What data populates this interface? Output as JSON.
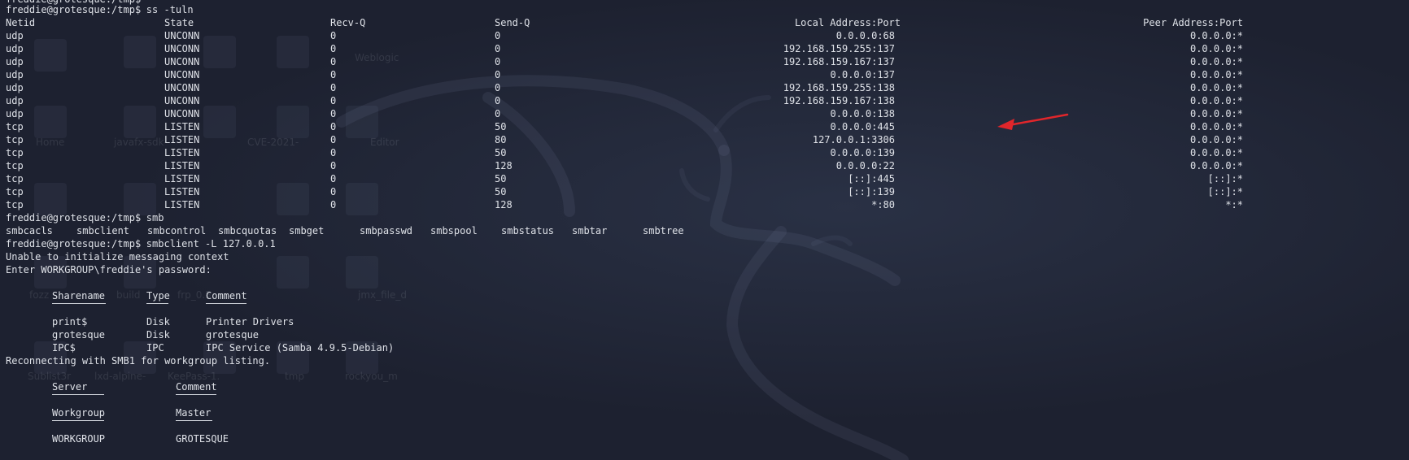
{
  "prompt": "freddie@grotesque:/tmp$",
  "commands": {
    "ss": "ss -tuln",
    "smb": "smb",
    "smbclient": "smbclient -L 127.0.0.1"
  },
  "ss_headers": [
    "Netid",
    "State",
    "Recv-Q",
    "Send-Q",
    "Local Address:Port",
    "Peer Address:Port"
  ],
  "ss_rows": [
    [
      "udp",
      "UNCONN",
      "0",
      "0",
      "0.0.0.0:68",
      "0.0.0.0:*"
    ],
    [
      "udp",
      "UNCONN",
      "0",
      "0",
      "192.168.159.255:137",
      "0.0.0.0:*"
    ],
    [
      "udp",
      "UNCONN",
      "0",
      "0",
      "192.168.159.167:137",
      "0.0.0.0:*"
    ],
    [
      "udp",
      "UNCONN",
      "0",
      "0",
      "0.0.0.0:137",
      "0.0.0.0:*"
    ],
    [
      "udp",
      "UNCONN",
      "0",
      "0",
      "192.168.159.255:138",
      "0.0.0.0:*"
    ],
    [
      "udp",
      "UNCONN",
      "0",
      "0",
      "192.168.159.167:138",
      "0.0.0.0:*"
    ],
    [
      "udp",
      "UNCONN",
      "0",
      "0",
      "0.0.0.0:138",
      "0.0.0.0:*"
    ],
    [
      "tcp",
      "LISTEN",
      "0",
      "50",
      "0.0.0.0:445",
      "0.0.0.0:*"
    ],
    [
      "tcp",
      "LISTEN",
      "0",
      "80",
      "127.0.0.1:3306",
      "0.0.0.0:*"
    ],
    [
      "tcp",
      "LISTEN",
      "0",
      "50",
      "0.0.0.0:139",
      "0.0.0.0:*"
    ],
    [
      "tcp",
      "LISTEN",
      "0",
      "128",
      "0.0.0.0:22",
      "0.0.0.0:*"
    ],
    [
      "tcp",
      "LISTEN",
      "0",
      "50",
      "[::]:445",
      "[::]:*"
    ],
    [
      "tcp",
      "LISTEN",
      "0",
      "50",
      "[::]:139",
      "[::]:*"
    ],
    [
      "tcp",
      "LISTEN",
      "0",
      "128",
      "*:80",
      "*:*"
    ]
  ],
  "completions": [
    "smbcacls",
    "smbclient",
    "smbcontrol",
    "smbcquotas",
    "smbget",
    "smbpasswd",
    "smbspool",
    "smbstatus",
    "smbtar",
    "smbtree"
  ],
  "smb_messages": [
    "Unable to initialize messaging context",
    "Enter WORKGROUP\\freddie's password:"
  ],
  "share_headers": [
    "Sharename",
    "Type",
    "Comment"
  ],
  "shares": [
    [
      "print$",
      "Disk",
      "Printer Drivers"
    ],
    [
      "grotesque",
      "Disk",
      "grotesque"
    ],
    [
      "IPC$",
      "IPC",
      "IPC Service (Samba 4.9.5-Debian)"
    ]
  ],
  "reconnect_message": "Reconnecting with SMB1 for workgroup listing.",
  "server_headers": [
    "Server",
    "Comment"
  ],
  "workgroup_headers": [
    "Workgroup",
    "Master"
  ],
  "workgroups": [
    [
      "WORKGROUP",
      "GROTESQUE"
    ]
  ],
  "desktop_labels": [
    "Home",
    "Weblogic",
    "javafx-sdk-",
    "CVE-2021-",
    "Editor",
    "fozz",
    "build",
    "frp_0.5",
    "jmx_file_d",
    "Sublist3r",
    "lxd-alpine-",
    "KeePass-1.",
    "tmp",
    "rockyou_m"
  ],
  "colors": {
    "background": "#1d2130",
    "text": "#dfe2e8",
    "arrow": "#e0262b"
  }
}
